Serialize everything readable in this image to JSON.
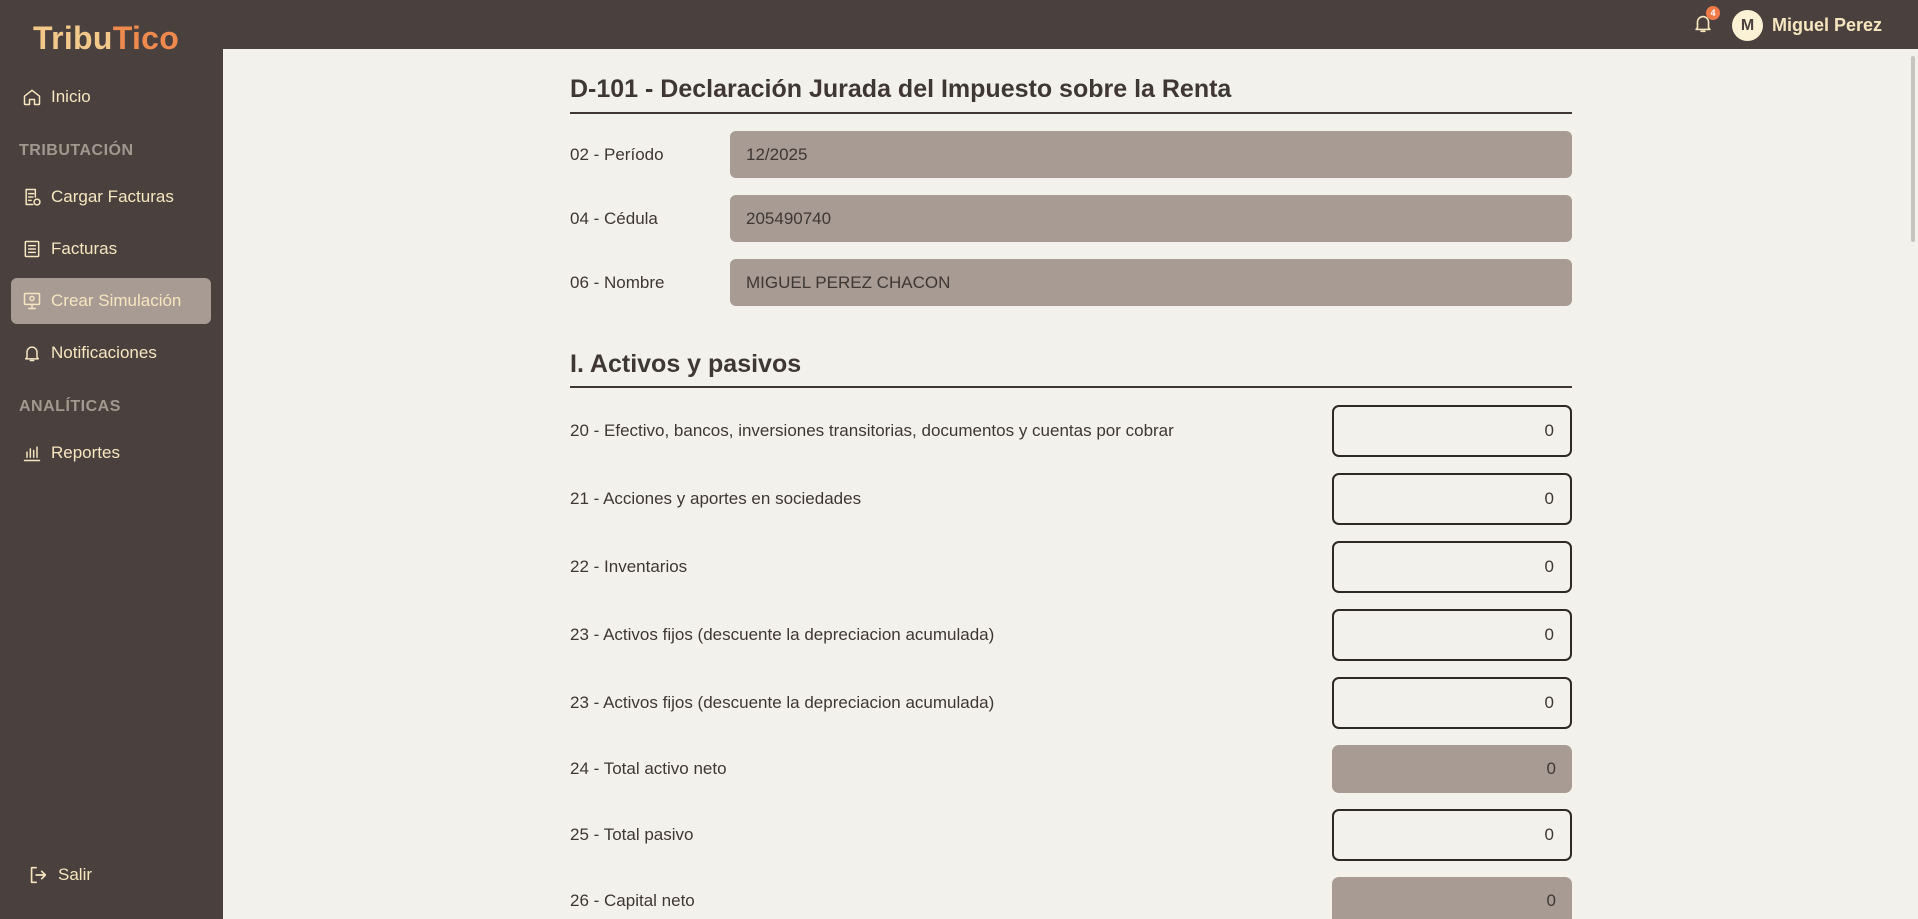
{
  "brand": {
    "part1": "Tribu",
    "part2": "Tico",
    "color1": "#f3c98b",
    "color2": "#ef8a4e"
  },
  "sidebar": {
    "items": [
      {
        "label": "Inicio",
        "icon": "home-icon"
      },
      {
        "label": "Cargar Facturas",
        "icon": "upload-invoice-icon"
      },
      {
        "label": "Facturas",
        "icon": "list-icon"
      },
      {
        "label": "Crear Simulación",
        "icon": "simulation-icon",
        "active": true
      },
      {
        "label": "Notificaciones",
        "icon": "bell-icon"
      },
      {
        "label": "Reportes",
        "icon": "bar-chart-icon"
      }
    ],
    "sections": [
      "TRIBUTACIÓN",
      "ANALÍTICAS"
    ],
    "logout_label": "Salir"
  },
  "topbar": {
    "notification_count": "4",
    "avatar_initial": "M",
    "user_name": "Miguel Perez"
  },
  "form": {
    "title": "D-101 - Declaración Jurada del Impuesto sobre la Renta",
    "header_fields": [
      {
        "label": "02 - Período",
        "value": "12/2025"
      },
      {
        "label": "04 - Cédula",
        "value": "205490740"
      },
      {
        "label": "06 - Nombre",
        "value": "MIGUEL PEREZ CHACON"
      }
    ],
    "section1_title": "I. Activos y pasivos",
    "section1_fields": [
      {
        "label": "20 - Efectivo, bancos, inversiones transitorias, documentos y cuentas por cobrar",
        "value": "0",
        "editable": true
      },
      {
        "label": "21 - Acciones y aportes en sociedades",
        "value": "0",
        "editable": true
      },
      {
        "label": "22 - Inventarios",
        "value": "0",
        "editable": true
      },
      {
        "label": "23 - Activos fijos (descuente la depreciacion acumulada)",
        "value": "0",
        "editable": true
      },
      {
        "label": "23 - Activos fijos (descuente la depreciacion acumulada)",
        "value": "0",
        "editable": true
      },
      {
        "label": "24 - Total activo neto",
        "value": "0",
        "editable": false
      },
      {
        "label": "25 - Total pasivo",
        "value": "0",
        "editable": true
      },
      {
        "label": "26 - Capital neto",
        "value": "0",
        "editable": false
      }
    ]
  },
  "colors": {
    "sidebar_bg": "#4a403e",
    "active_bg": "#a89b93",
    "page_bg": "#f3f1ec",
    "nav_text": "#f6e6bf"
  }
}
